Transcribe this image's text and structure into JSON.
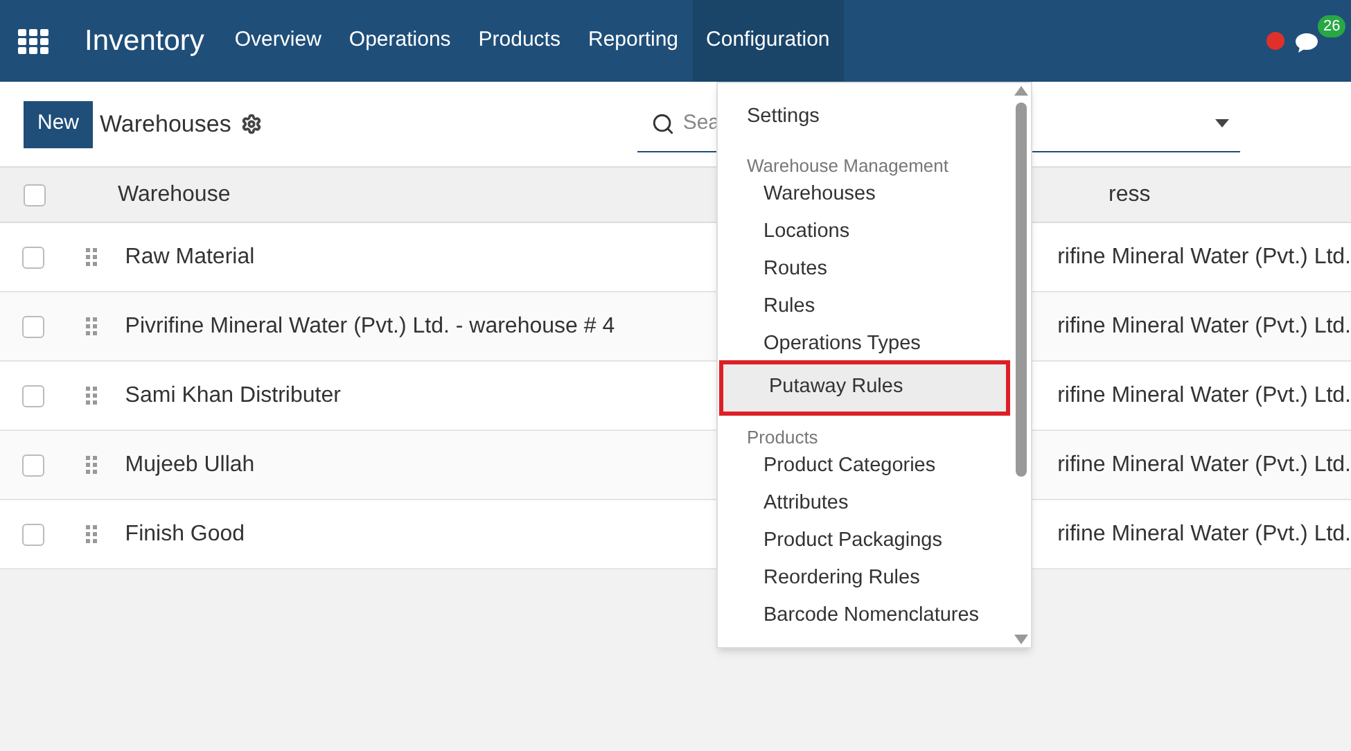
{
  "navbar": {
    "app_title": "Inventory",
    "menu": [
      {
        "label": "Overview",
        "selected": false
      },
      {
        "label": "Operations",
        "selected": false
      },
      {
        "label": "Products",
        "selected": false
      },
      {
        "label": "Reporting",
        "selected": false
      },
      {
        "label": "Configuration",
        "selected": true
      }
    ],
    "message_count": "26"
  },
  "control_panel": {
    "new_button": "New",
    "breadcrumb": "Warehouses",
    "search": {
      "placeholder": "Sea"
    }
  },
  "table": {
    "all_checked": false,
    "columns": [
      "Warehouse",
      "ress"
    ],
    "rows": [
      {
        "warehouse": "Raw Material",
        "address": "rifine Mineral Water (Pvt.) Ltd.",
        "checked": false
      },
      {
        "warehouse": "Pivrifine Mineral Water (Pvt.) Ltd. - warehouse # 4",
        "address": "rifine Mineral Water (Pvt.) Ltd.",
        "checked": false
      },
      {
        "warehouse": "Sami Khan Distributer",
        "address": "rifine Mineral Water (Pvt.) Ltd.",
        "checked": false
      },
      {
        "warehouse": "Mujeeb Ullah",
        "address": "rifine Mineral Water (Pvt.) Ltd.",
        "checked": false
      },
      {
        "warehouse": "Finish Good",
        "address": "rifine Mineral Water (Pvt.) Ltd.",
        "checked": false
      }
    ]
  },
  "dropdown": {
    "items": [
      {
        "kind": "item",
        "label": "Settings",
        "highlighted": false
      },
      {
        "kind": "section",
        "label": "Warehouse Management"
      },
      {
        "kind": "subitem",
        "label": "Warehouses",
        "highlighted": false
      },
      {
        "kind": "subitem",
        "label": "Locations",
        "highlighted": false
      },
      {
        "kind": "subitem",
        "label": "Routes",
        "highlighted": false
      },
      {
        "kind": "subitem",
        "label": "Rules",
        "highlighted": false
      },
      {
        "kind": "subitem",
        "label": "Operations Types",
        "highlighted": false
      },
      {
        "kind": "subitem",
        "label": "Putaway Rules",
        "highlighted": true
      },
      {
        "kind": "section",
        "label": "Products"
      },
      {
        "kind": "subitem",
        "label": "Product Categories",
        "highlighted": false
      },
      {
        "kind": "subitem",
        "label": "Attributes",
        "highlighted": false
      },
      {
        "kind": "subitem",
        "label": "Product Packagings",
        "highlighted": false
      },
      {
        "kind": "subitem",
        "label": "Reordering Rules",
        "highlighted": false
      },
      {
        "kind": "subitem",
        "label": "Barcode Nomenclatures",
        "highlighted": false
      }
    ]
  }
}
